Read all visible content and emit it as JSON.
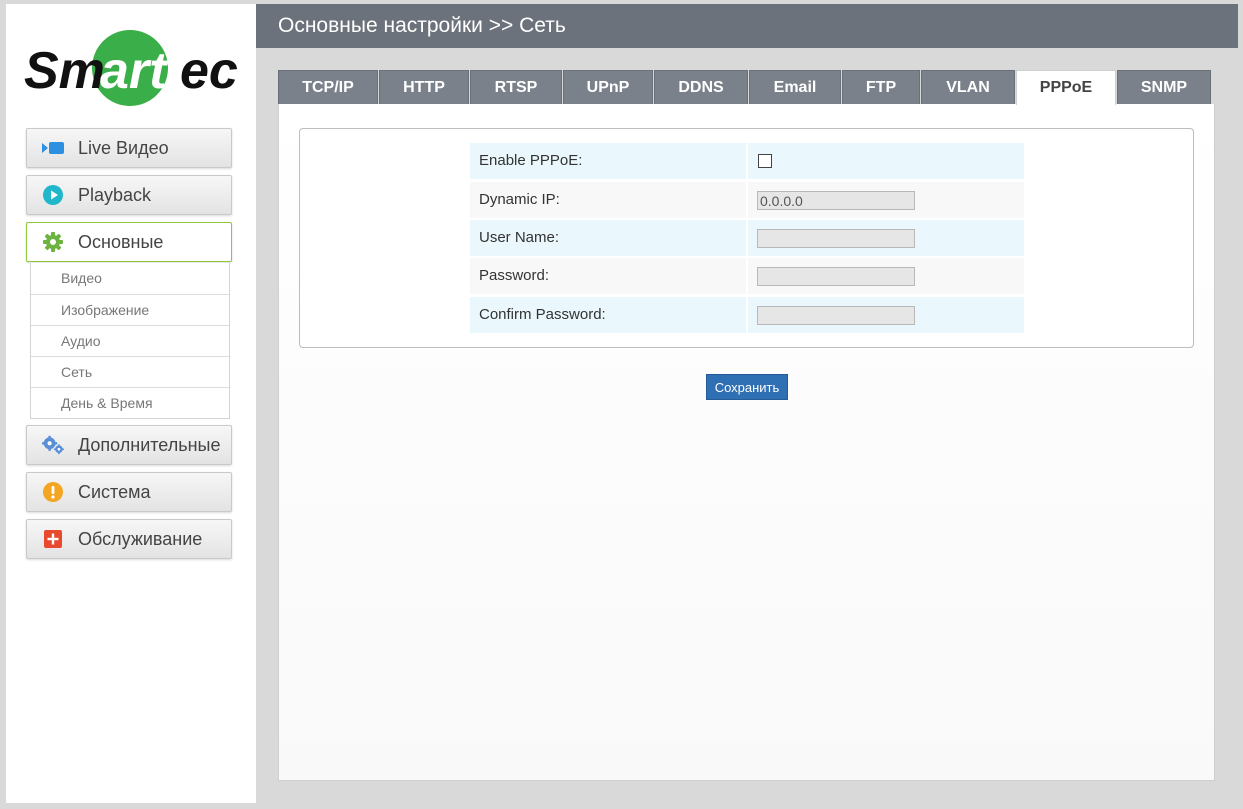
{
  "brand": {
    "logo_text_left": "Sm",
    "logo_text_mid": "art",
    "logo_text_right": "ec",
    "green": "#3aae49"
  },
  "header": {
    "title": "Основные настройки >> Сеть"
  },
  "sidebar": {
    "menu": [
      {
        "label": "Live Видео",
        "icon": "video-icon"
      },
      {
        "label": "Playback",
        "icon": "play-icon"
      },
      {
        "label": "Основные",
        "icon": "gear-icon"
      },
      {
        "label": "Дополнительные",
        "icon": "gears-icon"
      },
      {
        "label": "Система",
        "icon": "warning-icon"
      },
      {
        "label": "Обслуживание",
        "icon": "plus-icon"
      }
    ],
    "submenu": [
      "Видео",
      "Изображение",
      "Аудио",
      "Сеть",
      "День & Время"
    ]
  },
  "tabs": [
    "TCP/IP",
    "HTTP",
    "RTSP",
    "UPnP",
    "DDNS",
    "Email",
    "FTP",
    "VLAN",
    "PPPoE",
    "SNMP"
  ],
  "active_tab": "PPPoE",
  "form": {
    "enable_label": "Enable PPPoE:",
    "enable_checked": false,
    "dynamic_ip_label": "Dynamic IP:",
    "dynamic_ip_value": "0.0.0.0",
    "username_label": "User Name:",
    "username_value": "",
    "password_label": "Password:",
    "password_value": "",
    "confirm_label": "Confirm Password:",
    "confirm_value": ""
  },
  "save_label": "Сохранить",
  "colors": {
    "header": "#6c727b",
    "tab": "#7b818a",
    "accent_blue": "#2f6fb4",
    "active_border": "#8fc73e"
  }
}
